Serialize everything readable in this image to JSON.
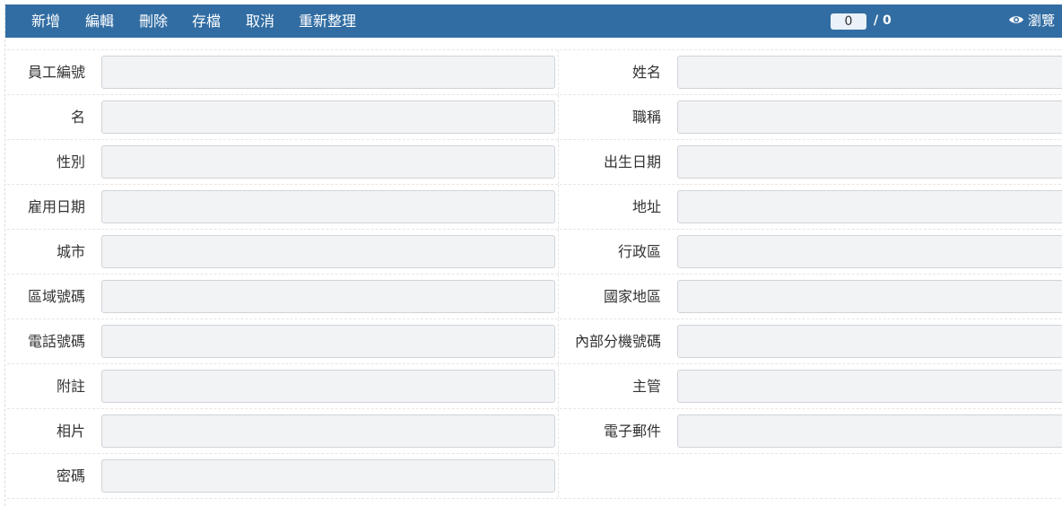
{
  "toolbar": {
    "buttons": [
      "新增",
      "編輯",
      "刪除",
      "存檔",
      "取消",
      "重新整理"
    ],
    "pager_current": "0",
    "pager_total": "/ 0",
    "browse_label": "瀏覽",
    "background": "#316da3"
  },
  "form": {
    "rows": [
      {
        "left": "員工編號",
        "right": "姓名"
      },
      {
        "left": "名",
        "right": "職稱"
      },
      {
        "left": "性別",
        "right": "出生日期"
      },
      {
        "left": "雇用日期",
        "right": "地址"
      },
      {
        "left": "城市",
        "right": "行政區"
      },
      {
        "left": "區域號碼",
        "right": "國家地區"
      },
      {
        "left": "電話號碼",
        "right": "內部分機號碼"
      },
      {
        "left": "附註",
        "right": "主管"
      },
      {
        "left": "相片",
        "right": "電子郵件"
      },
      {
        "left": "密碼",
        "right": ""
      }
    ]
  }
}
